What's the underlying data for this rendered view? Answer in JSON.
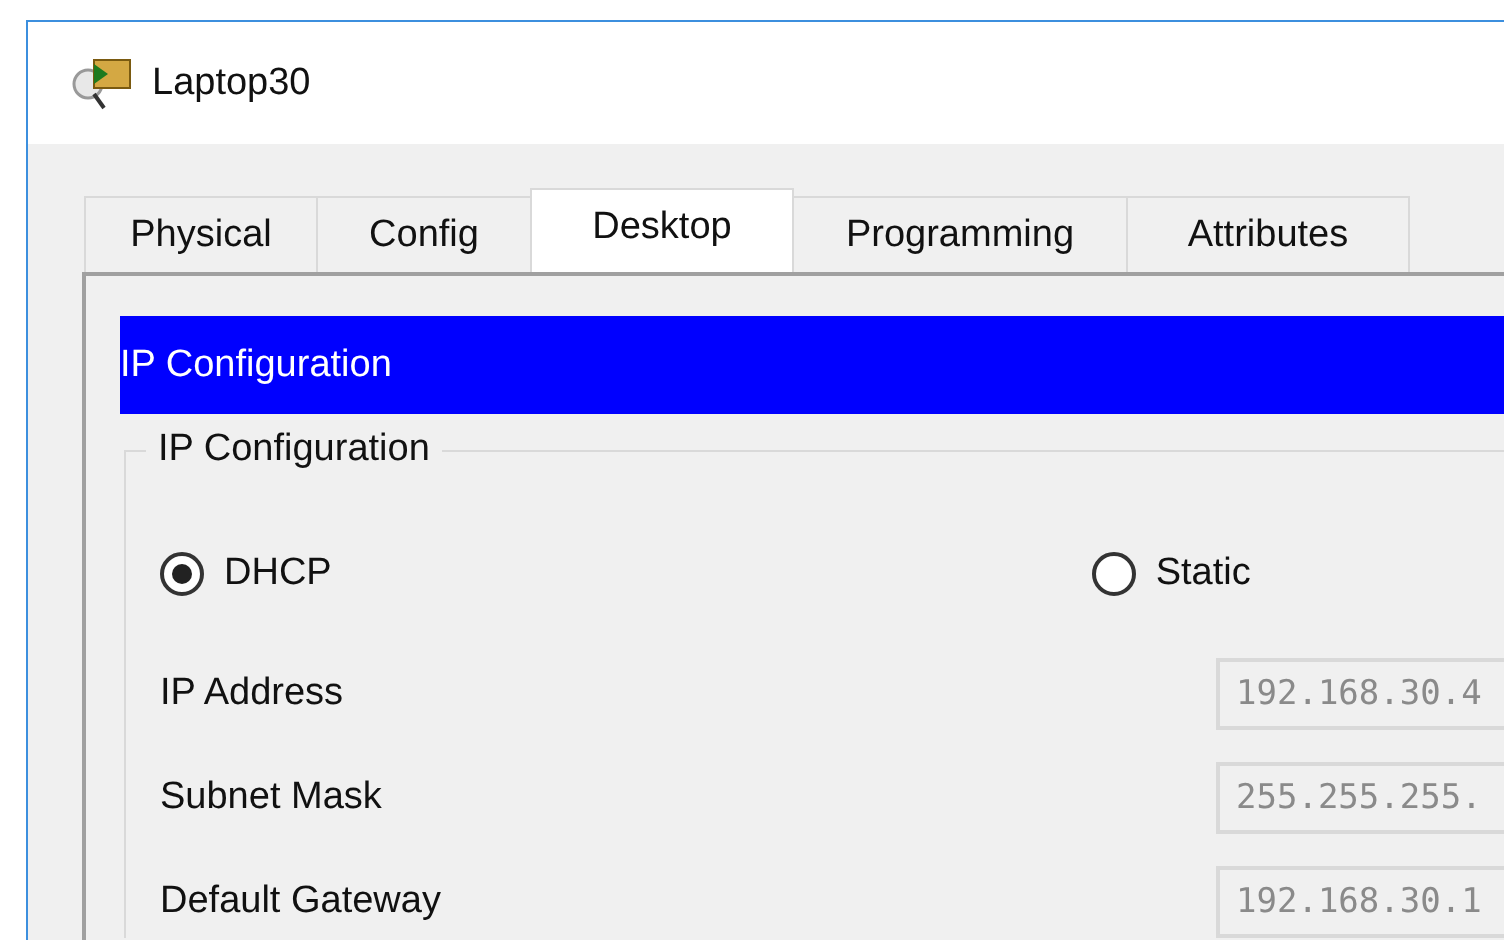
{
  "window": {
    "title": "Laptop30"
  },
  "tabs": [
    {
      "label": "Physical",
      "selected": false
    },
    {
      "label": "Config",
      "selected": false
    },
    {
      "label": "Desktop",
      "selected": true
    },
    {
      "label": "Programming",
      "selected": false
    },
    {
      "label": "Attributes",
      "selected": false
    }
  ],
  "header": {
    "title": "IP Configuration"
  },
  "group": {
    "title": "IP Configuration",
    "modes": [
      {
        "label": "DHCP",
        "selected": true
      },
      {
        "label": "Static",
        "selected": false
      }
    ],
    "fields": [
      {
        "label": "IP Address",
        "value": "192.168.30.4",
        "disabled": true
      },
      {
        "label": "Subnet Mask",
        "value": "255.255.255.",
        "disabled": true
      },
      {
        "label": "Default Gateway",
        "value": "192.168.30.1",
        "disabled": true
      }
    ]
  }
}
